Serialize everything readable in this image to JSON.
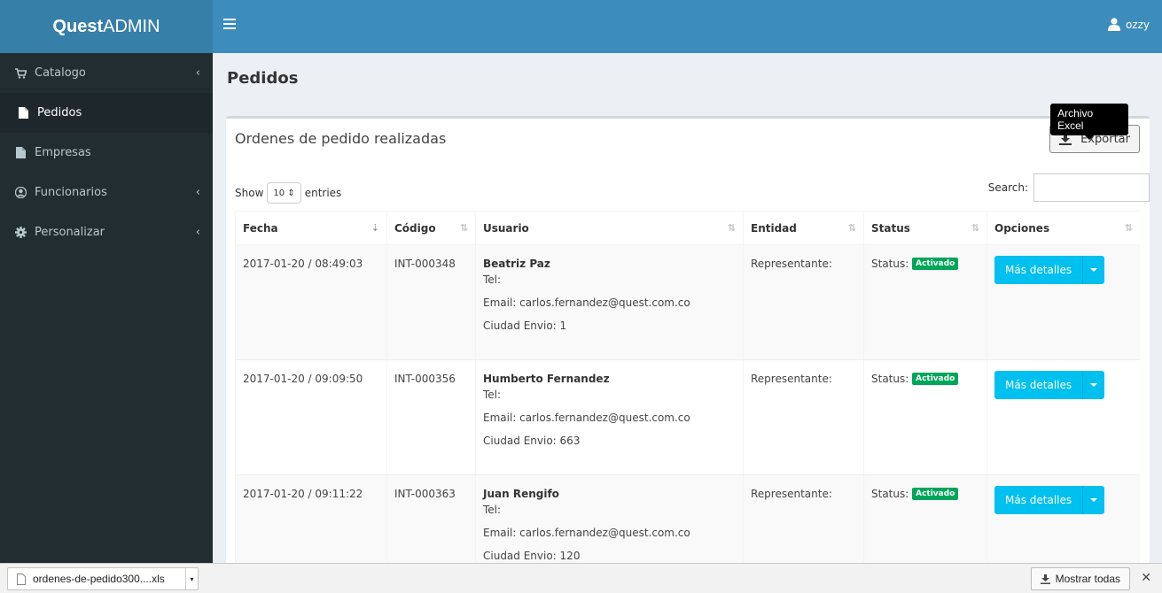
{
  "header": {
    "logo_bold": "Quest",
    "logo_light": "ADMIN",
    "username": "ozzy"
  },
  "sidebar": {
    "items": [
      {
        "label": "Catalogo",
        "icon": "cart-icon"
      },
      {
        "label": "Pedidos",
        "icon": "file-icon"
      },
      {
        "label": "Empresas",
        "icon": "file-icon"
      },
      {
        "label": "Funcionarios",
        "icon": "user-circle-icon"
      },
      {
        "label": "Personalizar",
        "icon": "gear-icon"
      }
    ]
  },
  "page": {
    "title": "Pedidos",
    "box_title": "Ordenes de pedido realizadas",
    "export_label": "Exportar",
    "export_tooltip": "Archivo Excel",
    "show_label": "Show",
    "entries_value": "10",
    "entries_label": "entries",
    "search_label": "Search:"
  },
  "table": {
    "headers": [
      "Fecha",
      "Código",
      "Usuario",
      "Entidad",
      "Status",
      "Opciones"
    ],
    "rows": [
      {
        "fecha": "2017-01-20 / 08:49:03",
        "codigo": "INT-000348",
        "nombre": "Beatriz Paz",
        "tel": "Tel:",
        "email": "Email: carlos.fernandez@quest.com.co",
        "ciudad": "Ciudad Envio: 1",
        "entidad": "Representante:",
        "status_label": "Status:",
        "status": "Activado",
        "action": "Más detalles"
      },
      {
        "fecha": "2017-01-20 / 09:09:50",
        "codigo": "INT-000356",
        "nombre": "Humberto Fernandez",
        "tel": "Tel:",
        "email": "Email: carlos.fernandez@quest.com.co",
        "ciudad": "Ciudad Envio: 663",
        "entidad": "Representante:",
        "status_label": "Status:",
        "status": "Activado",
        "action": "Más detalles"
      },
      {
        "fecha": "2017-01-20 / 09:11:22",
        "codigo": "INT-000363",
        "nombre": "Juan Rengifo",
        "tel": "Tel:",
        "email": "Email: carlos.fernandez@quest.com.co",
        "ciudad": "Ciudad Envio: 120",
        "entidad": "Representante:",
        "status_label": "Status:",
        "status": "Activado",
        "action": "Más detalles"
      }
    ]
  },
  "downloads": {
    "file_name": "ordenes-de-pedido300....xls",
    "show_all": "Mostrar todas"
  },
  "colors": {
    "header": "#3c8dbc",
    "logo_bg": "#367fa9",
    "sidebar": "#222d32",
    "info_button": "#00c0ef",
    "success_badge": "#00a65a"
  }
}
